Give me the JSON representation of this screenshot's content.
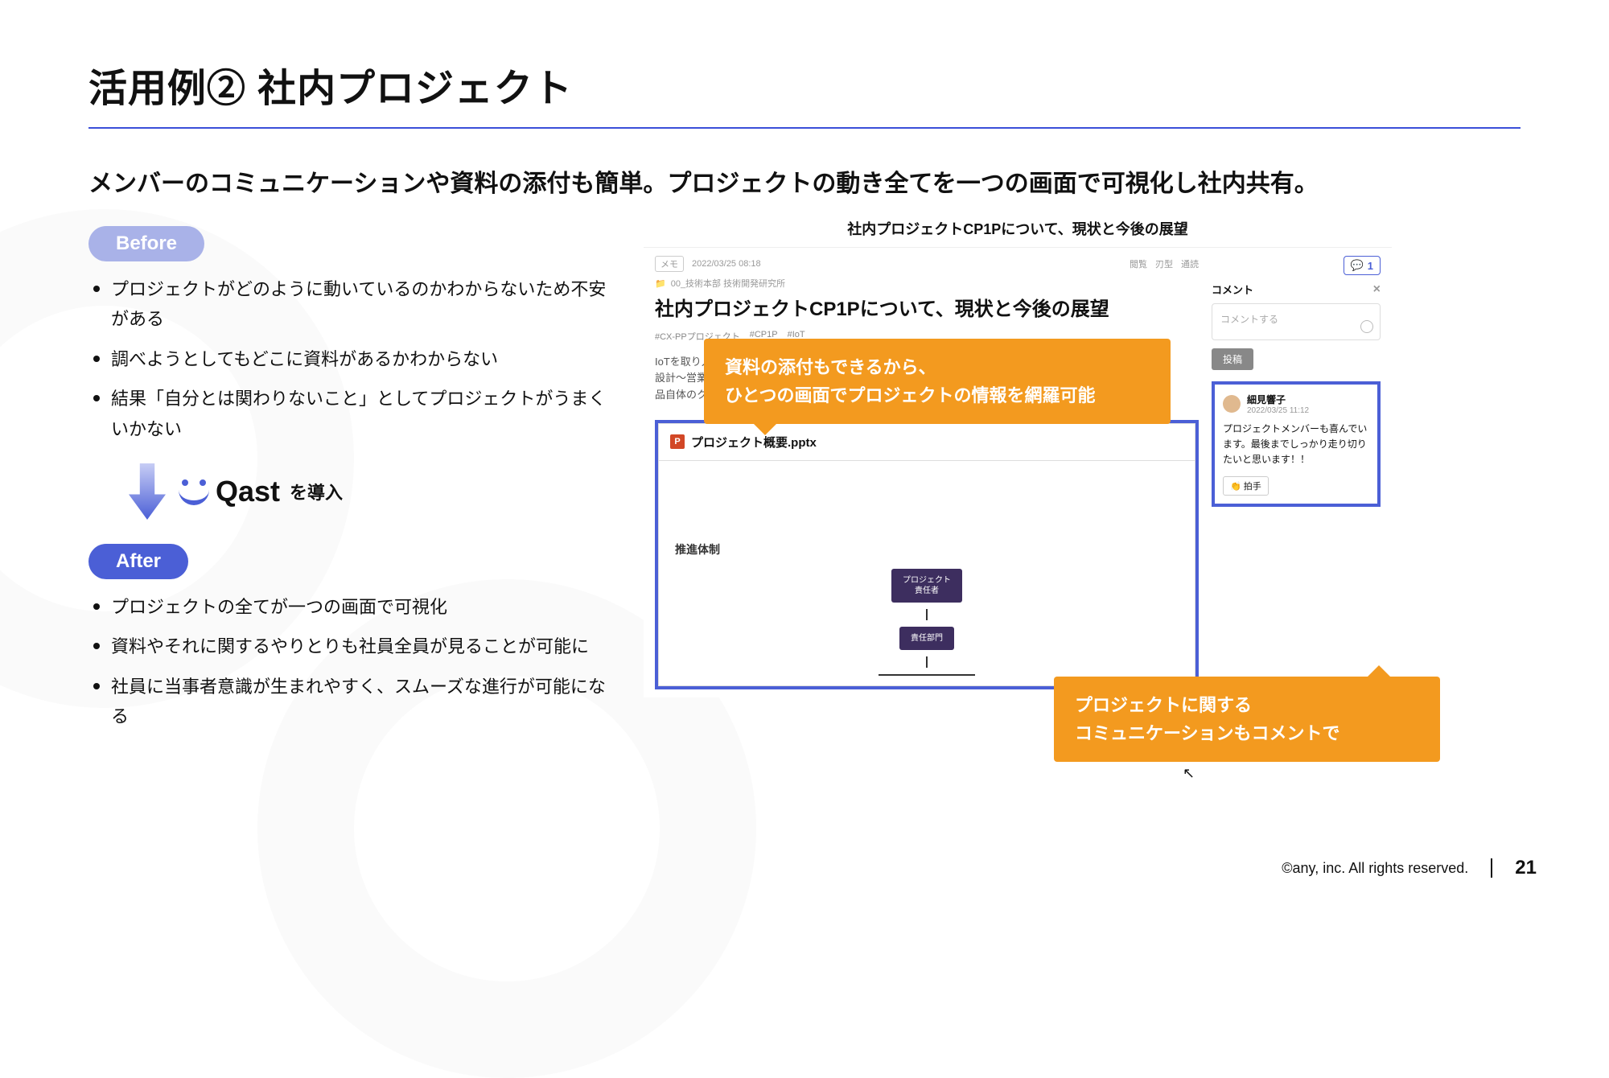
{
  "title": "活用例② 社内プロジェクト",
  "subtitle": "メンバーのコミュニケーションや資料の添付も簡単。プロジェクトの動き全てを一つの画面で可視化し社内共有。",
  "before": {
    "label": "Before",
    "items": [
      "プロジェクトがどのように動いているのかわからないため不安がある",
      "調べようとしてもどこに資料があるかわからない",
      "結果「自分とは関わりないこと」としてプロジェクトがうまくいかない"
    ]
  },
  "logo": {
    "name": "Qast",
    "suffix": "を導入"
  },
  "after": {
    "label": "After",
    "items": [
      "プロジェクトの全てが一つの画面で可視化",
      "資料やそれに関するやりとりも社員全員が見ることが可能に",
      "社員に当事者意識が生まれやすく、スムーズな進行が可能になる"
    ]
  },
  "mock": {
    "header": "社内プロジェクトCP1Pについて、現状と今後の展望",
    "crumb_tag": "メモ",
    "crumb_date": "2022/03/25 08:18",
    "crumb_folder": "00_技術本部 技術開発研究所",
    "meta": {
      "views": "閲覧",
      "refs": "刃型",
      "likes": "通読"
    },
    "title": "社内プロジェクトCP1Pについて、現状と今後の展望",
    "tags": [
      "#CX-PPプロジェクト",
      "#CP1P",
      "#IoT"
    ],
    "desc_l1": "IoTを取り入れ",
    "desc_l2": "設計〜営業や",
    "desc_l3": "品自体のクオ",
    "attachment": "プロジェクト概要.pptx",
    "ppt_icon": "P",
    "preview_title": "推進体制",
    "org_top": "プロジェクト\n責任者",
    "org_mid": "責任部門",
    "comment_badge": "1",
    "side_title": "コメント",
    "input_placeholder": "コメントする",
    "post": "投稿",
    "comment": {
      "name": "細見響子",
      "date": "2022/03/25 11:12",
      "body": "プロジェクトメンバーも喜んでいます。最後までしっかり走り切りたいと思います！！",
      "clap": "拍手"
    }
  },
  "callouts": {
    "c1": "資料の添付もできるから、\nひとつの画面でプロジェクトの情報を網羅可能",
    "c2": "プロジェクトに関する\nコミュニケーションもコメントで"
  },
  "footer": {
    "copyright": "©any, inc. All rights reserved.",
    "page": "21"
  }
}
